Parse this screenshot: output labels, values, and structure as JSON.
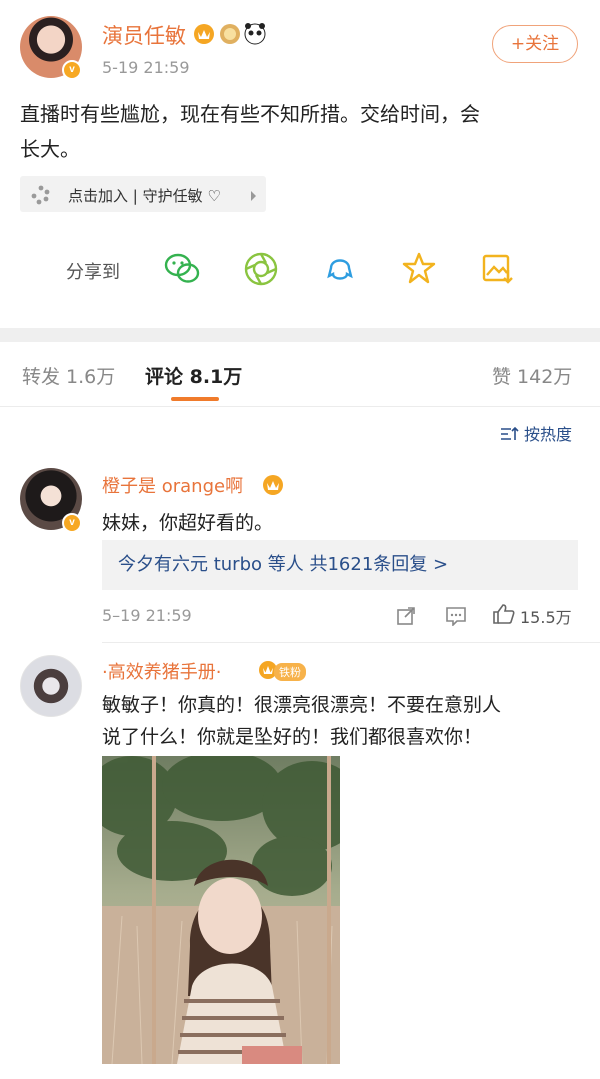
{
  "post": {
    "author": "演员任敏",
    "time": "5-19 21:59",
    "follow_label": "+关注",
    "text_line1": "直播时有些尴尬，现在有些不知所措。交给时间，会",
    "text_line2": "长大。",
    "superfan_label": "点击加入 | 守护任敏 ♡",
    "share_label": "分享到",
    "share_icons": [
      "wechat-icon",
      "moments-icon",
      "qq-icon",
      "qzone-icon",
      "save-image-icon"
    ]
  },
  "tabs": {
    "repost": "转发 1.6万",
    "comments": "评论 8.1万",
    "likes": "赞 142万"
  },
  "sort_label": "按热度",
  "comments": [
    {
      "name": "橙子是 orange啊",
      "text": "妹妹，你超好看的。",
      "replies": "今夕有六元 turbo 等人 共1621条回复 >",
      "time": "5–19 21:59",
      "likes": "15.5万"
    },
    {
      "name": "·高效养猪手册·",
      "badge": "铁粉",
      "text_line1": "敏敏子！你真的！很漂亮很漂亮！不要在意别人",
      "text_line2": "说了什么！你就是坠好的！我们都很喜欢你！"
    }
  ],
  "colors": {
    "accent": "#e8743b",
    "link": "#2a4f8a",
    "divider": "#efefef"
  }
}
